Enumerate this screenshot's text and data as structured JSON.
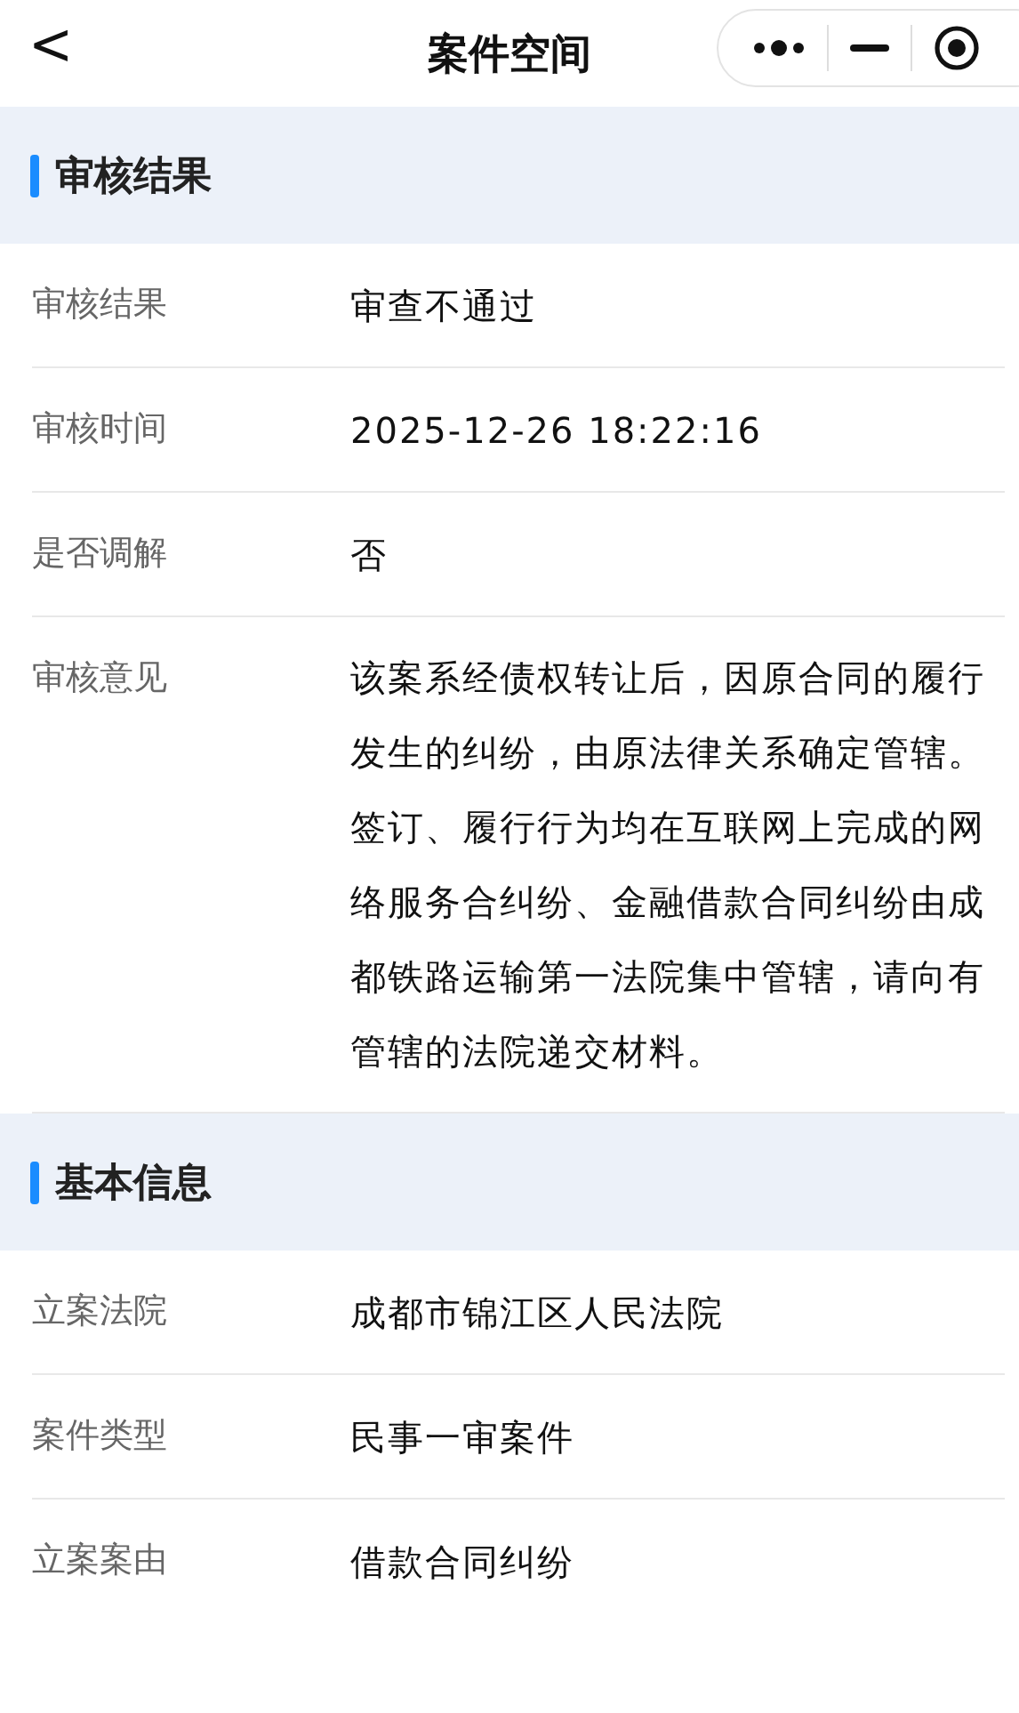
{
  "nav": {
    "back": "<",
    "title": "案件空间"
  },
  "sections": [
    {
      "title": "审核结果",
      "rows": [
        {
          "label": "审核结果",
          "value": "审查不通过"
        },
        {
          "label": "审核时间",
          "value": "2025-12-26 18:22:16"
        },
        {
          "label": "是否调解",
          "value": "否"
        },
        {
          "label": "审核意见",
          "value": "该案系经债权转让后，因原合同的履行发生的纠纷，由原法律关系确定管辖。签订、履行行为均在互联网上完成的网络服务合纠纷、金融借款合同纠纷由成都铁路运输第一法院集中管辖，请向有管辖的法院递交材料。"
        }
      ]
    },
    {
      "title": "基本信息",
      "rows": [
        {
          "label": "立案法院",
          "value": "成都市锦江区人民法院"
        },
        {
          "label": "案件类型",
          "value": "民事一审案件"
        },
        {
          "label": "立案案由",
          "value": "借款合同纠纷"
        }
      ]
    }
  ]
}
